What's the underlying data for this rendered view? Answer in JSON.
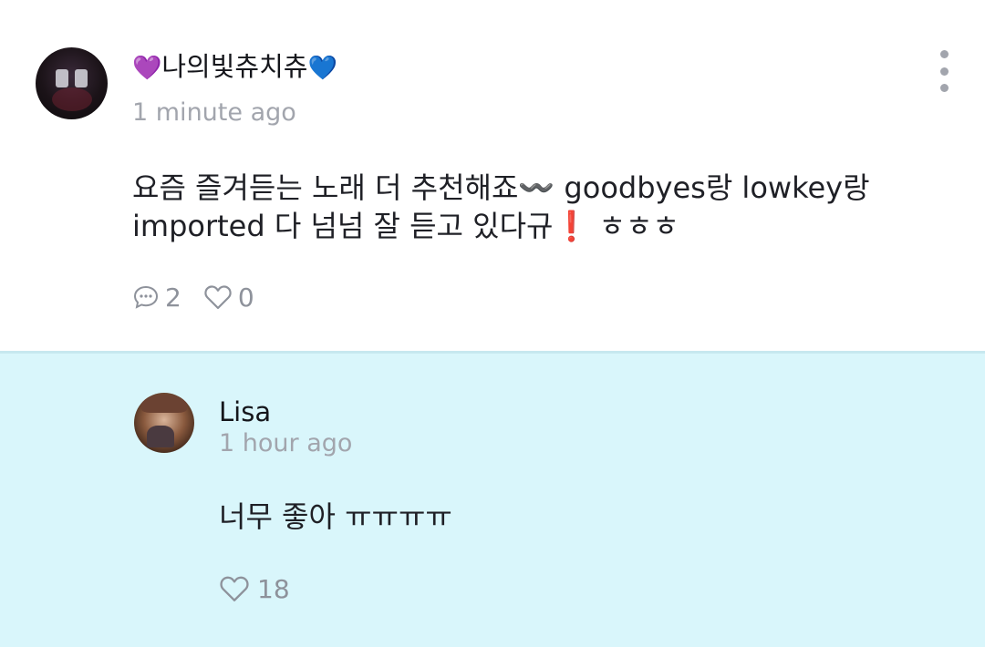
{
  "comment": {
    "username_text": "나의빛츄치츄",
    "username_emoji_left": "💜",
    "username_emoji_right": "💙",
    "time": "1 minute ago",
    "body_line1": "요즘 즐겨듣는 노래 더 추천해죠〰️ goodbyes랑 lowkey랑",
    "body_line2_prefix": "imported 다 넘넘 잘 듣고 있다규",
    "body_line2_emoji": "❗",
    "body_line2_suffix": " ㅎㅎㅎ",
    "reply_count": "2",
    "like_count": "0"
  },
  "reply": {
    "username": "Lisa",
    "time": "1 hour ago",
    "text": "너무 좋아 ㅠㅠㅠㅠ",
    "like_count": "18"
  },
  "colors": {
    "reply_background": "#d9f6fb",
    "muted_text": "#a2a5ad",
    "icon_gray": "#8e929b"
  },
  "icons": {
    "reply": "speech-bubble-icon",
    "like": "heart-outline-icon",
    "more": "vertical-ellipsis-icon"
  }
}
